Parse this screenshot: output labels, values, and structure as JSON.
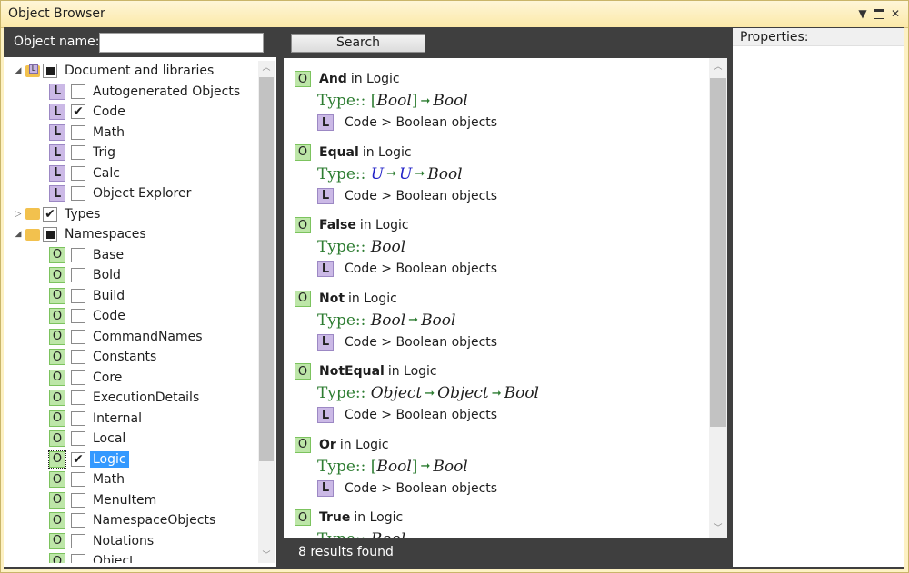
{
  "window": {
    "title": "Object Browser"
  },
  "left": {
    "object_name_label": "Object name:",
    "object_name_value": "",
    "tree": [
      {
        "level": 0,
        "expander": "◢",
        "kind": "folder-lib",
        "check": "indeterminate",
        "label": "Document and libraries"
      },
      {
        "level": 1,
        "kind": "L",
        "check": "unchecked",
        "label": "Autogenerated Objects"
      },
      {
        "level": 1,
        "kind": "L",
        "check": "checked",
        "label": "Code"
      },
      {
        "level": 1,
        "kind": "L",
        "check": "unchecked",
        "label": "Math"
      },
      {
        "level": 1,
        "kind": "L",
        "check": "unchecked",
        "label": "Trig"
      },
      {
        "level": 1,
        "kind": "L",
        "check": "unchecked",
        "label": "Calc"
      },
      {
        "level": 1,
        "kind": "L",
        "check": "unchecked",
        "label": "Object Explorer"
      },
      {
        "level": 0,
        "expander": "▷",
        "kind": "folder",
        "check": "checked",
        "label": "Types"
      },
      {
        "level": 0,
        "expander": "◢",
        "kind": "folder",
        "check": "indeterminate",
        "label": "Namespaces"
      },
      {
        "level": 1,
        "kind": "O",
        "check": "unchecked",
        "label": "Base"
      },
      {
        "level": 1,
        "kind": "O",
        "check": "unchecked",
        "label": "Bold"
      },
      {
        "level": 1,
        "kind": "O",
        "check": "unchecked",
        "label": "Build"
      },
      {
        "level": 1,
        "kind": "O",
        "check": "unchecked",
        "label": "Code"
      },
      {
        "level": 1,
        "kind": "O",
        "check": "unchecked",
        "label": "CommandNames"
      },
      {
        "level": 1,
        "kind": "O",
        "check": "unchecked",
        "label": "Constants"
      },
      {
        "level": 1,
        "kind": "O",
        "check": "unchecked",
        "label": "Core"
      },
      {
        "level": 1,
        "kind": "O",
        "check": "unchecked",
        "label": "ExecutionDetails"
      },
      {
        "level": 1,
        "kind": "O",
        "check": "unchecked",
        "label": "Internal"
      },
      {
        "level": 1,
        "kind": "O",
        "check": "unchecked",
        "label": "Local"
      },
      {
        "level": 1,
        "kind": "O",
        "check": "checked",
        "label": "Logic",
        "selected": true
      },
      {
        "level": 1,
        "kind": "O",
        "check": "unchecked",
        "label": "Math"
      },
      {
        "level": 1,
        "kind": "O",
        "check": "unchecked",
        "label": "MenuItem"
      },
      {
        "level": 1,
        "kind": "O",
        "check": "unchecked",
        "label": "NamespaceObjects"
      },
      {
        "level": 1,
        "kind": "O",
        "check": "unchecked",
        "label": "Notations"
      },
      {
        "level": 1,
        "kind": "O",
        "check": "unchecked",
        "label": "Object"
      }
    ]
  },
  "middle": {
    "search_label": "Search",
    "results": [
      {
        "name": "And",
        "in_text": "in Logic",
        "type_prefix": "Type::",
        "type": [
          [
            "lb",
            "["
          ],
          [
            "it",
            "Bool"
          ],
          [
            "lb",
            "]"
          ],
          [
            "arr",
            "➞"
          ],
          [
            "it",
            "Bool"
          ]
        ],
        "category": "Code > Boolean objects"
      },
      {
        "name": "Equal",
        "in_text": "in Logic",
        "type_prefix": "Type::",
        "type": [
          [
            "itb",
            "U"
          ],
          [
            "arr",
            "➞"
          ],
          [
            "itb",
            "U"
          ],
          [
            "arr",
            "➞"
          ],
          [
            "it",
            "Bool"
          ]
        ],
        "category": "Code > Boolean objects"
      },
      {
        "name": "False",
        "in_text": "in Logic",
        "type_prefix": "Type::",
        "type": [
          [
            "it",
            "Bool"
          ]
        ],
        "category": "Code > Boolean objects"
      },
      {
        "name": "Not",
        "in_text": "in Logic",
        "type_prefix": "Type::",
        "type": [
          [
            "it",
            "Bool"
          ],
          [
            "arr",
            "➞"
          ],
          [
            "it",
            "Bool"
          ]
        ],
        "category": "Code > Boolean objects"
      },
      {
        "name": "NotEqual",
        "in_text": "in Logic",
        "type_prefix": "Type::",
        "type": [
          [
            "it",
            "Object"
          ],
          [
            "arr",
            "➞"
          ],
          [
            "it",
            "Object"
          ],
          [
            "arr",
            "➞"
          ],
          [
            "it",
            "Bool"
          ]
        ],
        "category": "Code > Boolean objects"
      },
      {
        "name": "Or",
        "in_text": "in Logic",
        "type_prefix": "Type::",
        "type": [
          [
            "lb",
            "["
          ],
          [
            "it",
            "Bool"
          ],
          [
            "lb",
            "]"
          ],
          [
            "arr",
            "➞"
          ],
          [
            "it",
            "Bool"
          ]
        ],
        "category": "Code > Boolean objects"
      },
      {
        "name": "True",
        "in_text": "in Logic",
        "type_prefix": "Type::",
        "type": [
          [
            "it",
            "Bool"
          ]
        ],
        "category": ""
      }
    ],
    "status": "8 results found"
  },
  "right": {
    "properties_label": "Properties:"
  },
  "colors": {
    "title_bg": "#fdf1c3",
    "pane_dark": "#3f3f3f",
    "selection": "#3399ff",
    "badge_L": "#cbb9e6",
    "badge_O": "#bde6a8",
    "type_green": "#2e7d32",
    "type_blue": "#2424c8"
  }
}
